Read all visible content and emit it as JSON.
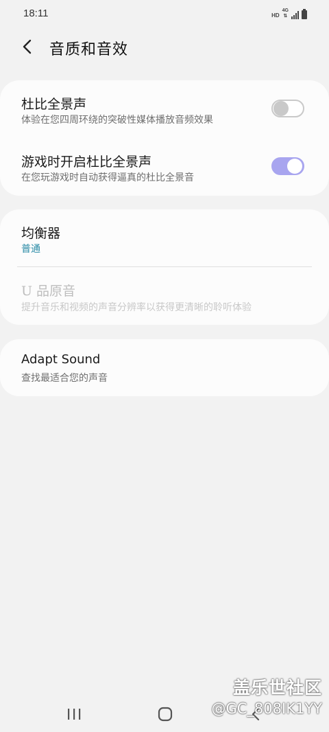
{
  "status_bar": {
    "time": "18:11",
    "hd": "HD",
    "network": "4G"
  },
  "header": {
    "title": "音质和音效"
  },
  "dolby": {
    "title": "杜比全景声",
    "subtitle": "体验在您四周环绕的突破性媒体播放音频效果",
    "enabled": false
  },
  "game_dolby": {
    "title": "游戏时开启杜比全景声",
    "subtitle": "在您玩游戏时自动获得逼真的杜比全景音",
    "enabled": true
  },
  "equalizer": {
    "title": "均衡器",
    "value": "普通"
  },
  "uhq": {
    "title": "U 品原音",
    "subtitle": "提升音乐和视频的声音分辨率以获得更清晰的聆听体验"
  },
  "adapt_sound": {
    "title": "Adapt Sound",
    "subtitle": "查找最适合您的声音"
  },
  "watermark": {
    "brand": "盖乐世社区",
    "user": "@GC_808IK1YY"
  },
  "colors": {
    "background": "#f2f2f2",
    "card": "#fcfcfc",
    "toggle_on": "#a8a5ef",
    "accent_text": "#2a8ba6"
  }
}
